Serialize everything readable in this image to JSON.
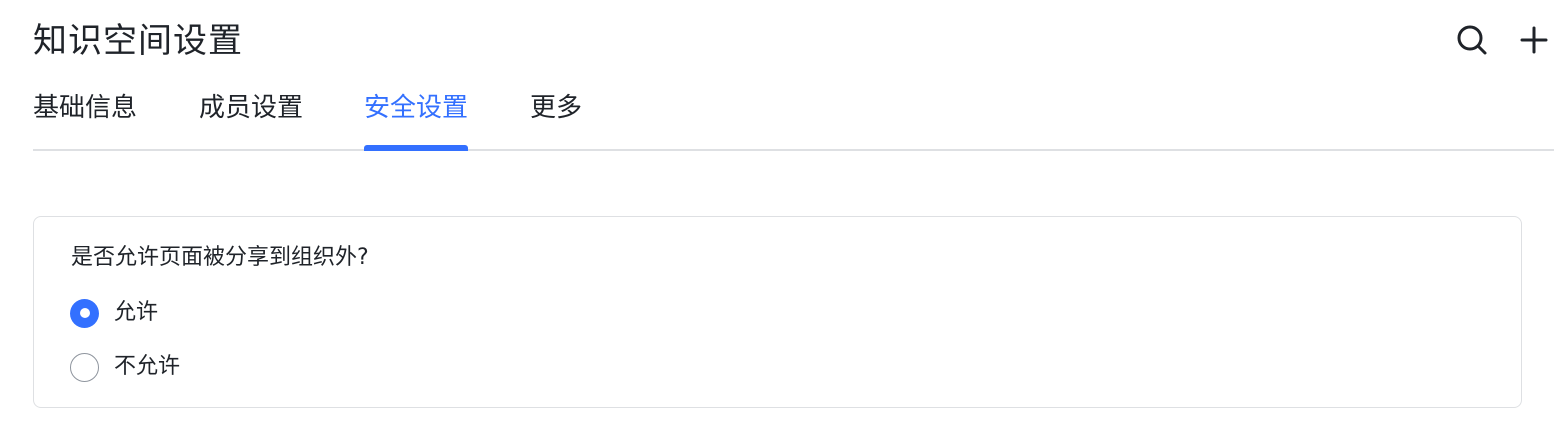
{
  "page": {
    "title": "知识空间设置"
  },
  "header": {
    "actions": [
      {
        "icon": "search-icon"
      },
      {
        "icon": "plus-icon"
      }
    ]
  },
  "tabs": [
    {
      "label": "基础信息",
      "active": false
    },
    {
      "label": "成员设置",
      "active": false
    },
    {
      "label": "安全设置",
      "active": true
    },
    {
      "label": "更多",
      "active": false
    }
  ],
  "security": {
    "question": "是否允许页面被分享到组织外?",
    "options": [
      {
        "label": "允许",
        "selected": true
      },
      {
        "label": "不允许",
        "selected": false
      }
    ]
  },
  "colors": {
    "accent": "#3370ff",
    "text": "#1f2329",
    "border": "#dee0e3"
  }
}
